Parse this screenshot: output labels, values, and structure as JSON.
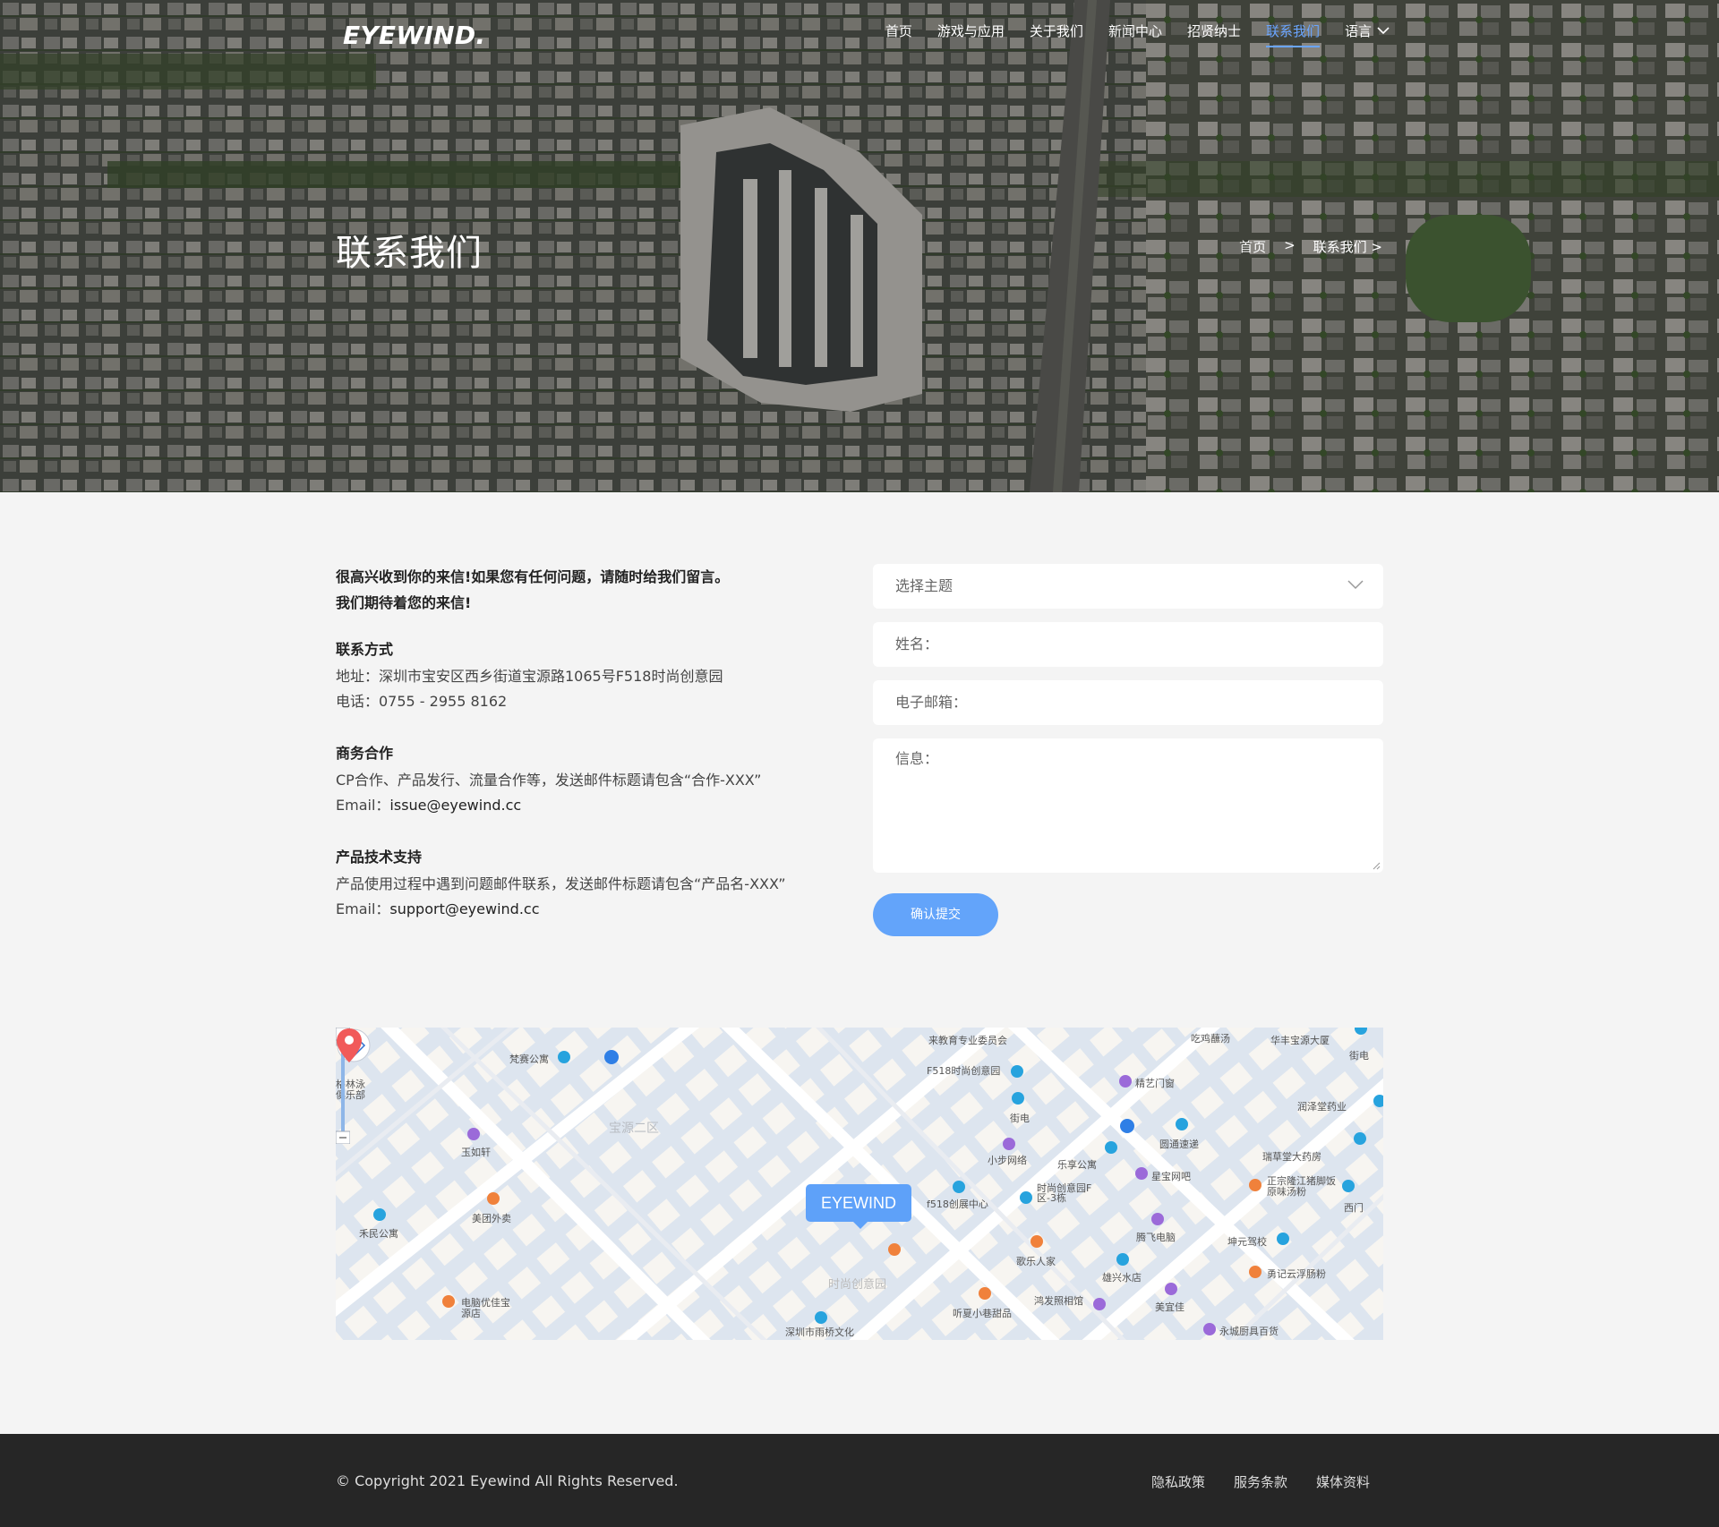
{
  "header": {
    "logo": "EYEWIND.",
    "nav": [
      {
        "label": "首页"
      },
      {
        "label": "游戏与应用"
      },
      {
        "label": "关于我们"
      },
      {
        "label": "新闻中心"
      },
      {
        "label": "招贤纳士"
      },
      {
        "label": "联系我们",
        "active": true
      },
      {
        "label": "语言"
      }
    ]
  },
  "hero": {
    "title": "联系我们",
    "breadcrumb": {
      "home": "首页",
      "sep": ">",
      "current": "联系我们 >"
    }
  },
  "contact": {
    "intro_line1": "很高兴收到你的来信!如果您有任何问题，请随时给我们留言。",
    "intro_line2": "我们期待着您的来信!",
    "method": {
      "title": "联系方式",
      "address": "地址：深圳市宝安区西乡街道宝源路1065号F518时尚创意园",
      "phone": "电话：0755 - 2955 8162"
    },
    "business": {
      "title": "商务合作",
      "desc": "CP合作、产品发行、流量合作等，发送邮件标题请包含“合作-XXX”",
      "email_label": "Email：",
      "email": "issue@eyewind.cc"
    },
    "support": {
      "title": "产品技术支持",
      "desc": "产品使用过程中遇到问题邮件联系，发送邮件标题请包含“产品名-XXX”",
      "email_label": "Email：",
      "email": "support@eyewind.cc"
    }
  },
  "form": {
    "subject_placeholder": "选择主题",
    "name_placeholder": "姓名：",
    "email_placeholder": "电子邮箱：",
    "message_placeholder": "信息：",
    "submit": "确认提交"
  },
  "map": {
    "marker_label": "EYEWIND",
    "areas": [
      "宝源二区"
    ],
    "labels": [
      "来教育专业委员会",
      "F518时尚创意园",
      "小步网络",
      "乐享公寓",
      "精艺门窗",
      "圆通速递",
      "星宝网吧",
      "润泽堂药业",
      "瑞草堂大药房",
      "正宗隆江猪脚饭原味汤粉",
      "坤元驾校",
      "勇记云浮肠粉",
      "腾飞电脑",
      "雄兴水店",
      "美宜佳",
      "永城厨具百货",
      "鸿发照相馆",
      "歌乐人家",
      "听夏小巷甜品",
      "深圳市雨桥文化",
      "时尚创意园",
      "f518创展中心",
      "时尚创意园F区-3栋",
      "玉如轩",
      "美团外卖",
      "禾民公寓",
      "电脑优佳宝源店",
      "梵赛公寓",
      "华丰宝源大厦",
      "吃鸡蘸汤",
      "街电",
      "街电",
      "西门",
      "格林泳俱乐部"
    ]
  },
  "footer": {
    "copyright": "© Copyright 2021 Eyewind All Rights Reserved.",
    "links": [
      "隐私政策",
      "服务条款",
      "媒体资料"
    ]
  }
}
